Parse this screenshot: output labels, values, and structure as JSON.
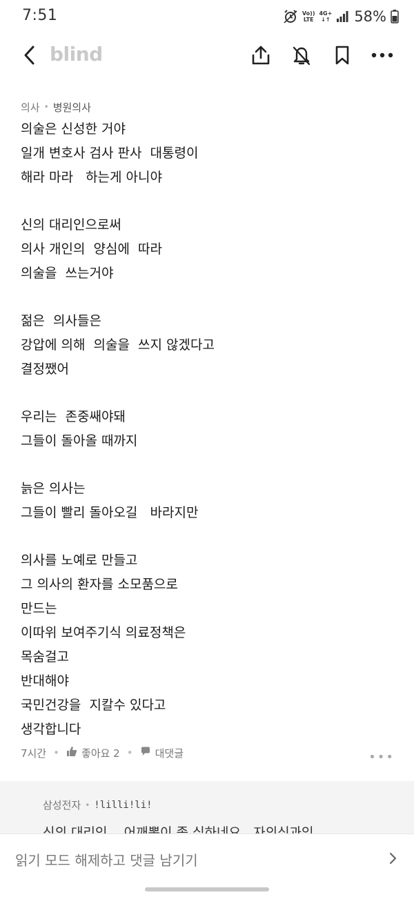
{
  "status": {
    "time": "7:51",
    "network_top": "Vo))",
    "network_bottom": "LTE",
    "gen_top": "4G+",
    "gen_bottom": "↓↑",
    "battery": "58%"
  },
  "app": {
    "brand": "blind"
  },
  "post": {
    "category": "의사",
    "subcategory": "병원의사",
    "paragraphs": [
      [
        "의술은 신성한 거야",
        "일개 변호사 검사 판사  대통령이",
        "해라 마라   하는게 아니야"
      ],
      [
        "신의 대리인으로써",
        "의사 개인의  양심에  따라",
        "의술을  쓰는거야"
      ],
      [
        "젊은  의사들은",
        "강압에 의해  의술을  쓰지 않겠다고",
        "결정쨌어"
      ],
      [
        "우리는  존중쌔야돼",
        "그들이 돌아올 때까지"
      ],
      [
        "늙은 의사는",
        "그들이 빨리 돌아오길   바라지만"
      ],
      [
        "의사를 노예로 만들고",
        "그 의사의 환자를 소모품으로",
        "만드는",
        "이따위 보여주기식 의료정책은",
        "목숨걸고",
        "반대해야",
        "국민건강을  지칼수 있다고",
        "생각합니다"
      ]
    ],
    "time_ago": "7시간",
    "like_label": "좋아요 2",
    "reply_label": "대댓글"
  },
  "comment": {
    "company": "삼성전자",
    "nickname": "!lilli!li!",
    "text": "신의 대리인... 어깨뽕이 좀 심하네요.. 자의식과잉"
  },
  "bottom_bar": {
    "label": "읽기 모드 해제하고 댓글 남기기"
  },
  "colors": {
    "brand": "#c9c9c9",
    "comment_bg": "#f4f4f4"
  }
}
